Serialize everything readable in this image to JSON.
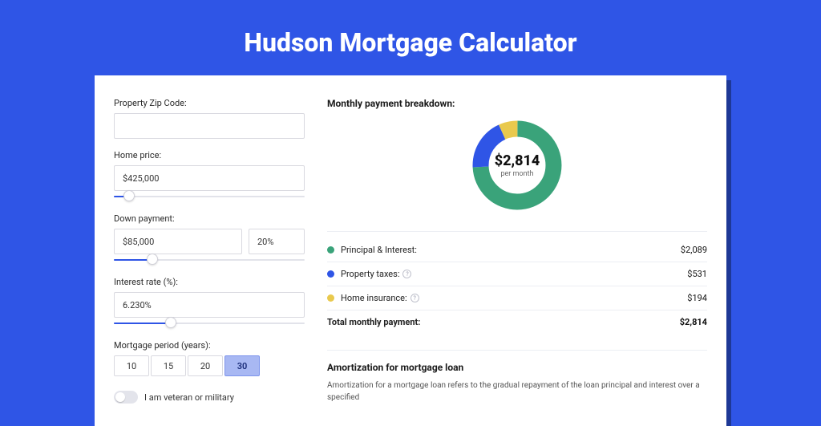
{
  "page": {
    "title": "Hudson Mortgage Calculator"
  },
  "form": {
    "zip": {
      "label": "Property Zip Code:",
      "value": ""
    },
    "price": {
      "label": "Home price:",
      "value": "$425,000",
      "slider_pct": 8
    },
    "down": {
      "label": "Down payment:",
      "amount": "$85,000",
      "pct": "20%",
      "slider_pct": 20
    },
    "rate": {
      "label": "Interest rate (%):",
      "value": "6.230%",
      "slider_pct": 30
    },
    "period": {
      "label": "Mortgage period (years):",
      "options": [
        "10",
        "15",
        "20",
        "30"
      ],
      "active": "30"
    },
    "veteran_label": "I am veteran or military"
  },
  "breakdown": {
    "title": "Monthly payment breakdown:",
    "center_value": "$2,814",
    "center_sub": "per month",
    "rows": [
      {
        "label": "Principal & Interest:",
        "value": "$2,089",
        "color": "#3aa37a",
        "help": false
      },
      {
        "label": "Property taxes:",
        "value": "$531",
        "color": "#2f55e6",
        "help": true
      },
      {
        "label": "Home insurance:",
        "value": "$194",
        "color": "#e9c94d",
        "help": true
      }
    ],
    "total": {
      "label": "Total monthly payment:",
      "value": "$2,814"
    }
  },
  "amort": {
    "title": "Amortization for mortgage loan",
    "text": "Amortization for a mortgage loan refers to the gradual repayment of the loan principal and interest over a specified"
  },
  "chart_data": {
    "type": "pie",
    "title": "Monthly payment breakdown",
    "series": [
      {
        "name": "Principal & Interest",
        "value": 2089,
        "color": "#3aa37a"
      },
      {
        "name": "Property taxes",
        "value": 531,
        "color": "#2f55e6"
      },
      {
        "name": "Home insurance",
        "value": 194,
        "color": "#e9c94d"
      }
    ],
    "total": 2814,
    "center_label": "$2,814 per month"
  }
}
